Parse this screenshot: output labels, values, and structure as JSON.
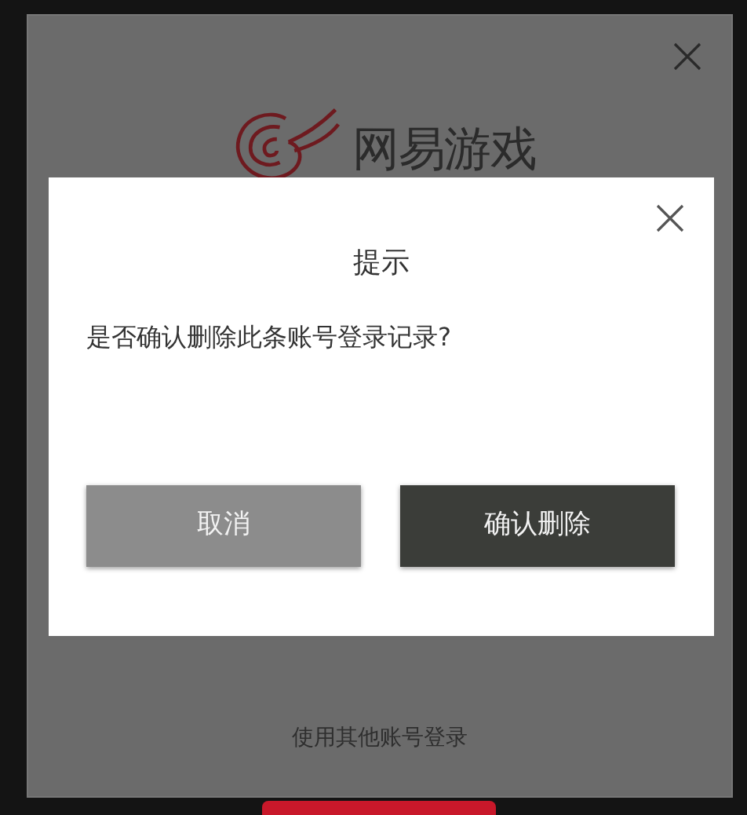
{
  "login_window": {
    "logo_text": "网易游戏",
    "alt_login_link": "使用其他账号登录"
  },
  "dialog": {
    "title": "提示",
    "message": "是否确认删除此条账号登录记录?",
    "buttons": [
      {
        "label": "取消",
        "kind": "secondary"
      },
      {
        "label": "确认删除",
        "kind": "primary"
      }
    ]
  }
}
